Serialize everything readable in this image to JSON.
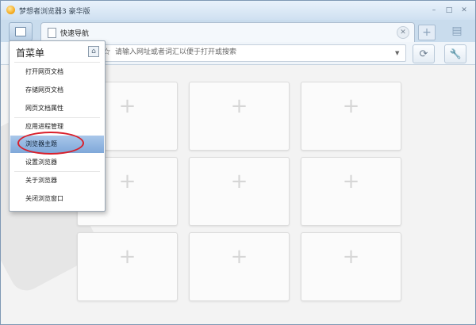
{
  "window": {
    "title": "梦想者浏览器3 豪华版",
    "controls": [
      "–",
      "□",
      "✕"
    ]
  },
  "tabs": [
    {
      "label": "快速导航"
    }
  ],
  "address_bar": {
    "placeholder": "请输入网址或者词汇以便于打开或搜索"
  },
  "menu": {
    "title": "首菜单",
    "items": [
      {
        "label": "打开网页文档"
      },
      {
        "label": "存储网页文档"
      },
      {
        "label": "网页文档属性"
      },
      {
        "label": "应用进程管理"
      },
      {
        "label": "浏览器主题",
        "active": true
      },
      {
        "label": "设置浏览器"
      },
      {
        "label": "关于浏览器"
      },
      {
        "label": "关闭浏览窗口"
      }
    ]
  },
  "speed_dial": {
    "tile_count": 9,
    "tile_symbol": "+"
  },
  "colors": {
    "highlight_ring": "#d91f2b",
    "active_item": "#7fa8d9"
  }
}
